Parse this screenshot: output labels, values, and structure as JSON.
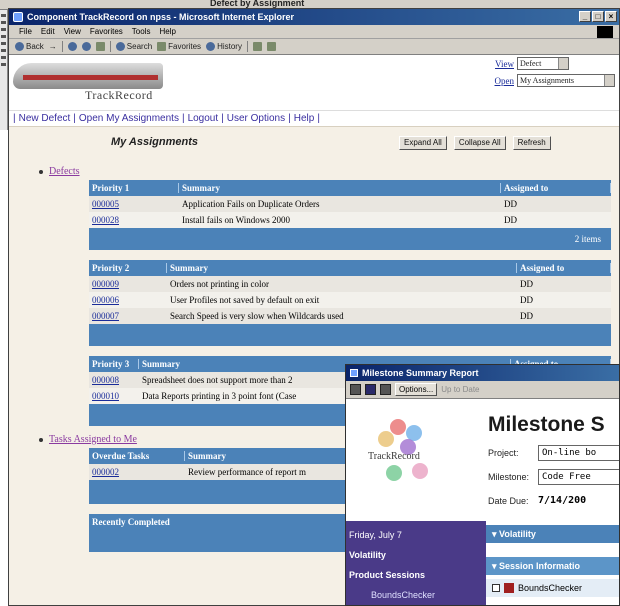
{
  "background_window": {
    "title": "Defect by Assignment"
  },
  "window": {
    "title": "Component TrackRecord on npss - Microsoft Internet Explorer",
    "controls": [
      "_",
      "□",
      "×"
    ],
    "menu": [
      "File",
      "Edit",
      "View",
      "Favorites",
      "Tools",
      "Help"
    ],
    "toolbar": [
      "Back",
      "→",
      "Stop",
      "Refresh",
      "Home",
      "Search",
      "Favorites",
      "History",
      "Mail",
      "Print"
    ]
  },
  "header": {
    "logo_text": "TrackRecord",
    "view_label": "View",
    "view_value": "Defect",
    "open_label": "Open",
    "open_value": "My Assignments"
  },
  "nav": [
    "New Defect",
    "Open My Assignments",
    "Logout",
    "User Options",
    "Help"
  ],
  "assignments": {
    "title": "My Assignments",
    "buttons": [
      "Expand All",
      "Collapse All",
      "Refresh"
    ]
  },
  "defects": {
    "label": "Defects",
    "groups": [
      {
        "headers": [
          "Priority 1",
          "Summary",
          "Assigned to"
        ],
        "rows": [
          {
            "id": "000005",
            "summary": "Application Fails on Duplicate Orders",
            "assigned": "DD"
          },
          {
            "id": "000028",
            "summary": "Install fails on Windows 2000",
            "assigned": "DD"
          }
        ],
        "footer": "2 items"
      },
      {
        "headers": [
          "Priority 2",
          "Summary",
          "Assigned to"
        ],
        "rows": [
          {
            "id": "000009",
            "summary": "Orders not printing in color",
            "assigned": "DD"
          },
          {
            "id": "000006",
            "summary": "User Profiles not saved by default on exit",
            "assigned": "DD"
          },
          {
            "id": "000007",
            "summary": "Search Speed is very slow when Wildcards used",
            "assigned": "DD"
          }
        ],
        "footer": ""
      },
      {
        "headers": [
          "Priority 3",
          "Summary",
          "Assigned to"
        ],
        "rows": [
          {
            "id": "000008",
            "summary": "Spreadsheet does not support more than 2",
            "assigned": ""
          },
          {
            "id": "000010",
            "summary": "Data Reports printing in 3 point font (Case",
            "assigned": ""
          }
        ],
        "footer": ""
      }
    ]
  },
  "tasks": {
    "label": "Tasks Assigned to Me",
    "headers": [
      "Overdue Tasks",
      "Summary"
    ],
    "rows": [
      {
        "id": "000002",
        "summary": "Review performance of report m"
      }
    ],
    "recent_header": "Recently Completed"
  },
  "milestone": {
    "window_title": "Milestone Summary Report",
    "options_label": "Options...",
    "update_label": "Up to Date",
    "heading": "Milestone S",
    "logo_text": "TrackRecord",
    "project_label": "Project:",
    "project_value": "On-line bo",
    "milestone_label": "Milestone:",
    "milestone_value": "Code Free",
    "due_label": "Date Due:",
    "due_value": "7/14/200",
    "left": [
      "Friday, July 7",
      "Volatility",
      "Product Sessions",
      "BoundsChecker"
    ],
    "bar_volatility": "Volatility",
    "bar_session": "Session Informatio",
    "sub_item": "BoundsChecker"
  }
}
